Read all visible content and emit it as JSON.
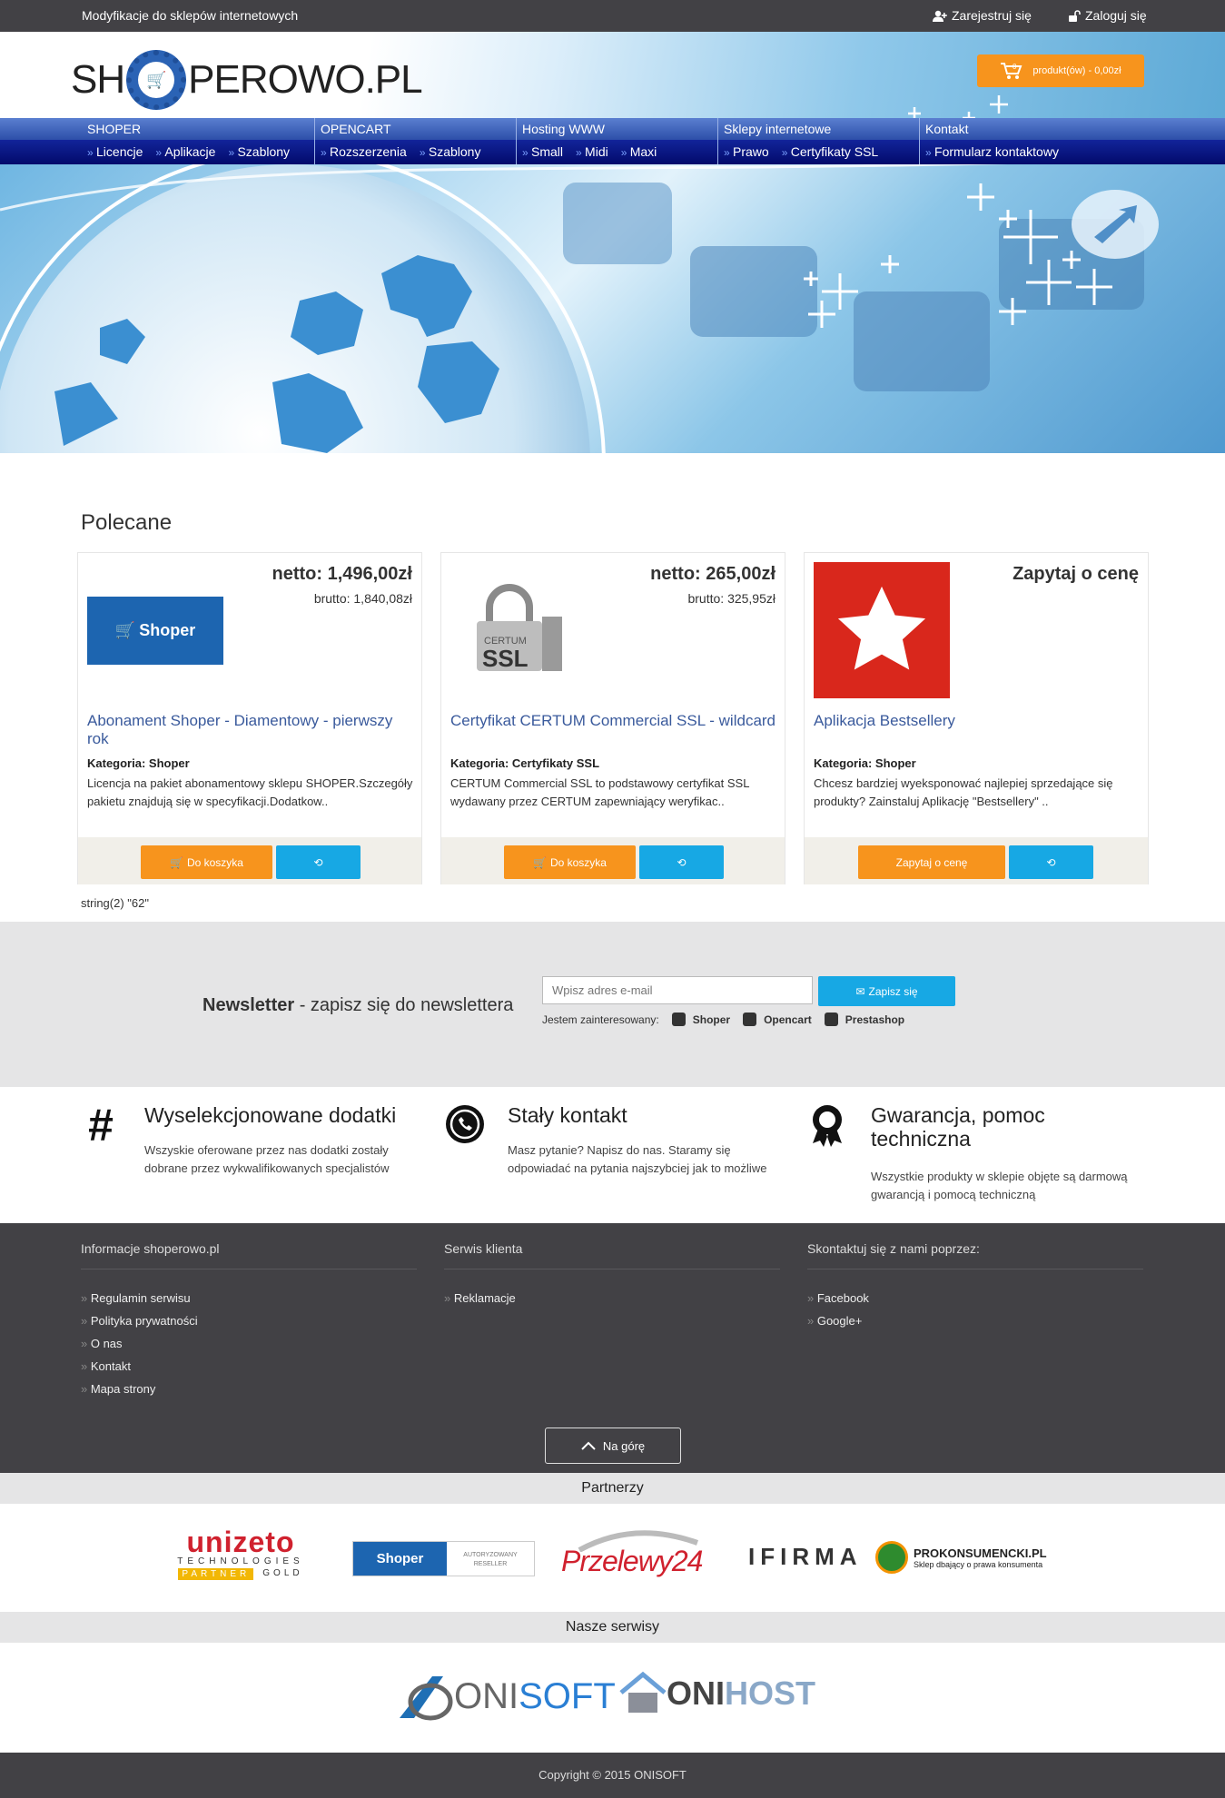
{
  "topbar": {
    "tagline": "Modyfikacje do sklepów internetowych",
    "register": "Zarejestruj się",
    "login": "Zaloguj się"
  },
  "header": {
    "logo_left": "SH",
    "logo_right": "PEROWO.PL",
    "cart": "produkt(ów) - 0,00zł",
    "cart_count": "0"
  },
  "nav": [
    {
      "label": "SHOPER",
      "subs": [
        "Licencje",
        "Aplikacje",
        "Szablony"
      ]
    },
    {
      "label": "OPENCART",
      "subs": [
        "Rozszerzenia",
        "Szablony"
      ]
    },
    {
      "label": "Hosting WWW",
      "subs": [
        "Small",
        "Midi",
        "Maxi"
      ]
    },
    {
      "label": "Sklepy internetowe",
      "subs": [
        "Prawo",
        "Certyfikaty SSL"
      ]
    },
    {
      "label": "Kontakt",
      "subs": [
        "Formularz kontaktowy"
      ]
    }
  ],
  "recommended": {
    "heading": "Polecane",
    "debug": "string(2) \"62\"",
    "products": [
      {
        "netto": "netto: 1,496,00zł",
        "brutto": "brutto: 1,840,08zł",
        "title": "Abonament Shoper - Diamentowy - pierwszy rok",
        "category_label": "Kategoria:",
        "category": "Shoper",
        "desc": "Licencja na pakiet abonamentowy sklepu SHOPER.Szczegóły pakietu znajdują się w specyfikacji.Dodatkow..",
        "button": "Do koszyka",
        "logo_text": "Shoper"
      },
      {
        "netto": "netto: 265,00zł",
        "brutto": "brutto: 325,95zł",
        "title": "Certyfikat CERTUM Commercial SSL - wildcard",
        "category_label": "Kategoria:",
        "category": "Certyfikaty SSL",
        "desc": "CERTUM Commercial SSL to podstawowy certyfikat SSL wydawany przez CERTUM zapewniający weryfikac..",
        "button": "Do koszyka",
        "logo_text": "SSL",
        "logo_top": "CERTUM"
      },
      {
        "netto": "Zapytaj o cenę",
        "brutto": "",
        "title": "Aplikacja Bestsellery",
        "category_label": "Kategoria:",
        "category": "Shoper",
        "desc": "Chcesz bardziej wyeksponować najlepiej sprzedające się produkty? Zainstaluj Aplikację \"Bestsellery\" ..",
        "button": "Zapytaj o cenę"
      }
    ]
  },
  "newsletter": {
    "label_bold": "Newsletter",
    "label_rest": " - zapisz się do newslettera",
    "placeholder": "Wpisz adres e-mail",
    "button": "Zapisz się",
    "interested": "Jestem zainteresowany:",
    "options": [
      "Shoper",
      "Opencart",
      "Prestashop"
    ]
  },
  "features": [
    {
      "title": "Wyselekcjonowane dodatki",
      "desc": "Wszyskie oferowane przez nas dodatki zostały dobrane przez wykwalifikowanych specjalistów",
      "icon": "hashtag-icon"
    },
    {
      "title": "Stały kontakt",
      "desc": "Masz pytanie? Napisz do nas. Staramy się odpowiadać na pytania najszybciej jak to możliwe",
      "icon": "phone-icon"
    },
    {
      "title": "Gwarancja, pomoc techniczna",
      "desc": "Wszystkie produkty w sklepie objęte są darmową gwarancją i pomocą techniczną",
      "icon": "award-icon"
    }
  ],
  "footer": {
    "columns": [
      {
        "title": "Informacje shoperowo.pl",
        "links": [
          "Regulamin serwisu",
          "Polityka prywatności",
          "O nas",
          "Kontakt",
          "Mapa strony"
        ]
      },
      {
        "title": "Serwis klienta",
        "links": [
          "Reklamacje"
        ]
      },
      {
        "title": "Skontaktuj się z nami poprzez:",
        "links": [
          "Facebook",
          "Google+"
        ]
      }
    ],
    "gotop": "Na górę"
  },
  "partners": {
    "heading": "Partnerzy",
    "unizeto": "unizeto",
    "unizeto_sub": "TECHNOLOGIES",
    "unizeto_partner": "PARTNER",
    "unizeto_gold": "GOLD",
    "shoper": "Shoper",
    "shoper_badge_1": "AUTORYZOWANY",
    "shoper_badge_2": "RESELLER",
    "przelewy": "Przelewy24",
    "ifirma": "IFIRMA",
    "prokons": "PROKONSUMENCKI.PL",
    "prokons_sub": "Sklep dbający o prawa konsumenta"
  },
  "services": {
    "heading": "Nasze serwisy",
    "onisoft_a": "ONI",
    "onisoft_b": "SOFT",
    "onihost_a": "ONI",
    "onihost_b": "HOST"
  },
  "copyright": "Copyright © 2015 ONISOFT",
  "colors": {
    "orange": "#f7941d",
    "blue": "#17a8e4",
    "dark": "#424145",
    "link": "#3a5a9c"
  }
}
